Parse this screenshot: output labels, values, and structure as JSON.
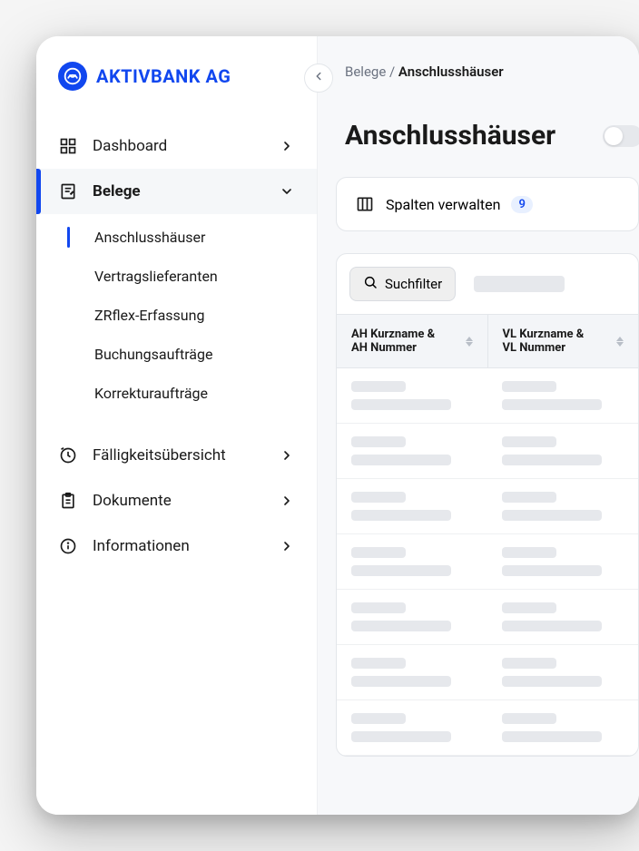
{
  "brand": {
    "name": "AKTIVBANK AG"
  },
  "breadcrumb": {
    "parent": "Belege",
    "separator": " / ",
    "current": "Anschlusshäuser"
  },
  "page": {
    "title": "Anschlusshäuser"
  },
  "columnsCard": {
    "label": "Spalten verwalten",
    "count": "9"
  },
  "toolbar": {
    "filter_label": "Suchfilter"
  },
  "table": {
    "columns": [
      {
        "line1": "AH Kurzname &",
        "line2": "AH Nummer"
      },
      {
        "line1": "VL Kurzname &",
        "line2": "VL Nummer"
      }
    ],
    "row_count": 7
  },
  "sidebar": {
    "items": [
      {
        "label": "Dashboard",
        "icon": "grid-icon",
        "expandable": true,
        "expanded": false
      },
      {
        "label": "Belege",
        "icon": "note-icon",
        "expandable": true,
        "expanded": true,
        "active": true,
        "children": [
          {
            "label": "Anschlusshäuser",
            "selected": true
          },
          {
            "label": "Vertragslieferanten"
          },
          {
            "label": "ZRflex-Erfassung"
          },
          {
            "label": "Buchungsaufträge"
          },
          {
            "label": "Korrekturaufträge"
          }
        ]
      },
      {
        "label": "Fälligkeitsübersicht",
        "icon": "clock-icon",
        "expandable": true,
        "expanded": false
      },
      {
        "label": "Dokumente",
        "icon": "clipboard-icon",
        "expandable": true,
        "expanded": false
      },
      {
        "label": "Informationen",
        "icon": "info-icon",
        "expandable": true,
        "expanded": false
      }
    ]
  }
}
